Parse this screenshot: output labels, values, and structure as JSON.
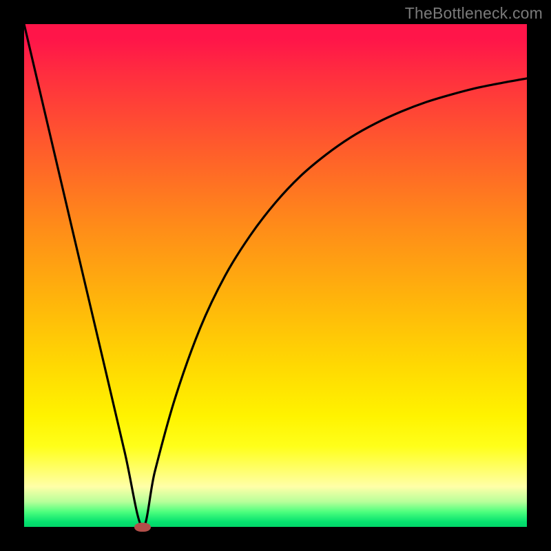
{
  "watermark": "TheBottleneck.com",
  "chart_data": {
    "type": "line",
    "title": "",
    "xlabel": "",
    "ylabel": "",
    "xlim": [
      0,
      100
    ],
    "ylim": [
      0,
      100
    ],
    "grid": false,
    "legend": false,
    "background": "rainbow-gradient",
    "series": [
      {
        "name": "left-branch",
        "x": [
          0,
          5,
          10,
          15,
          20,
          23.5
        ],
        "values": [
          100,
          78.7,
          57.4,
          36.2,
          14.9,
          0
        ]
      },
      {
        "name": "right-branch",
        "x": [
          23.5,
          26,
          30,
          35,
          40,
          45,
          50,
          55,
          60,
          65,
          70,
          75,
          80,
          85,
          90,
          95,
          100
        ],
        "values": [
          0,
          11,
          25.5,
          39.5,
          50,
          58,
          64.5,
          69.8,
          74,
          77.5,
          80.3,
          82.6,
          84.5,
          86,
          87.3,
          88.3,
          89.2
        ]
      }
    ],
    "marker": {
      "x": 23.5,
      "y": 0,
      "color": "#b24f4a"
    }
  }
}
